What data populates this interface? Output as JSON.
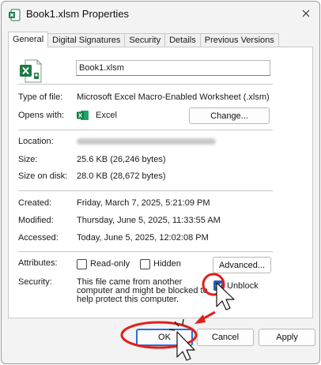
{
  "window": {
    "title": "Book1.xlsm Properties"
  },
  "tabs": [
    {
      "label": "General",
      "active": true
    },
    {
      "label": "Digital Signatures",
      "active": false
    },
    {
      "label": "Security",
      "active": false
    },
    {
      "label": "Details",
      "active": false
    },
    {
      "label": "Previous Versions",
      "active": false
    }
  ],
  "general": {
    "file_name": "Book1.xlsm",
    "type_label": "Type of file:",
    "type_value": "Microsoft Excel Macro-Enabled Worksheet (.xlsm)",
    "opens_label": "Opens with:",
    "opens_value": "Excel",
    "change_button": "Change...",
    "location_label": "Location:",
    "size_label": "Size:",
    "size_value": "25.6 KB (26,246 bytes)",
    "size_on_disk_label": "Size on disk:",
    "size_on_disk_value": "28.0 KB (28,672 bytes)",
    "created_label": "Created:",
    "created_value": "Friday, March 7, 2025, 5:21:09 PM",
    "modified_label": "Modified:",
    "modified_value": "Thursday, June 5, 2025, 11:33:55 AM",
    "accessed_label": "Accessed:",
    "accessed_value": "Today, June 5, 2025, 12:02:08 PM",
    "attributes_label": "Attributes:",
    "readonly_label": "Read-only",
    "readonly_checked": false,
    "hidden_label": "Hidden",
    "hidden_checked": false,
    "advanced_button": "Advanced...",
    "security_label": "Security:",
    "security_line1": "This file came from another",
    "security_line2": "computer and might be blocked to",
    "security_line3": "help protect this computer.",
    "unblock_label": "Unblock",
    "unblock_checked": true
  },
  "footer": {
    "ok_button": "OK",
    "cancel_button": "Cancel",
    "apply_button": "Apply"
  },
  "colors": {
    "annotation_red": "#e0201c",
    "excel_green": "#1d7a45",
    "accent_blue": "#1f5fbf"
  }
}
